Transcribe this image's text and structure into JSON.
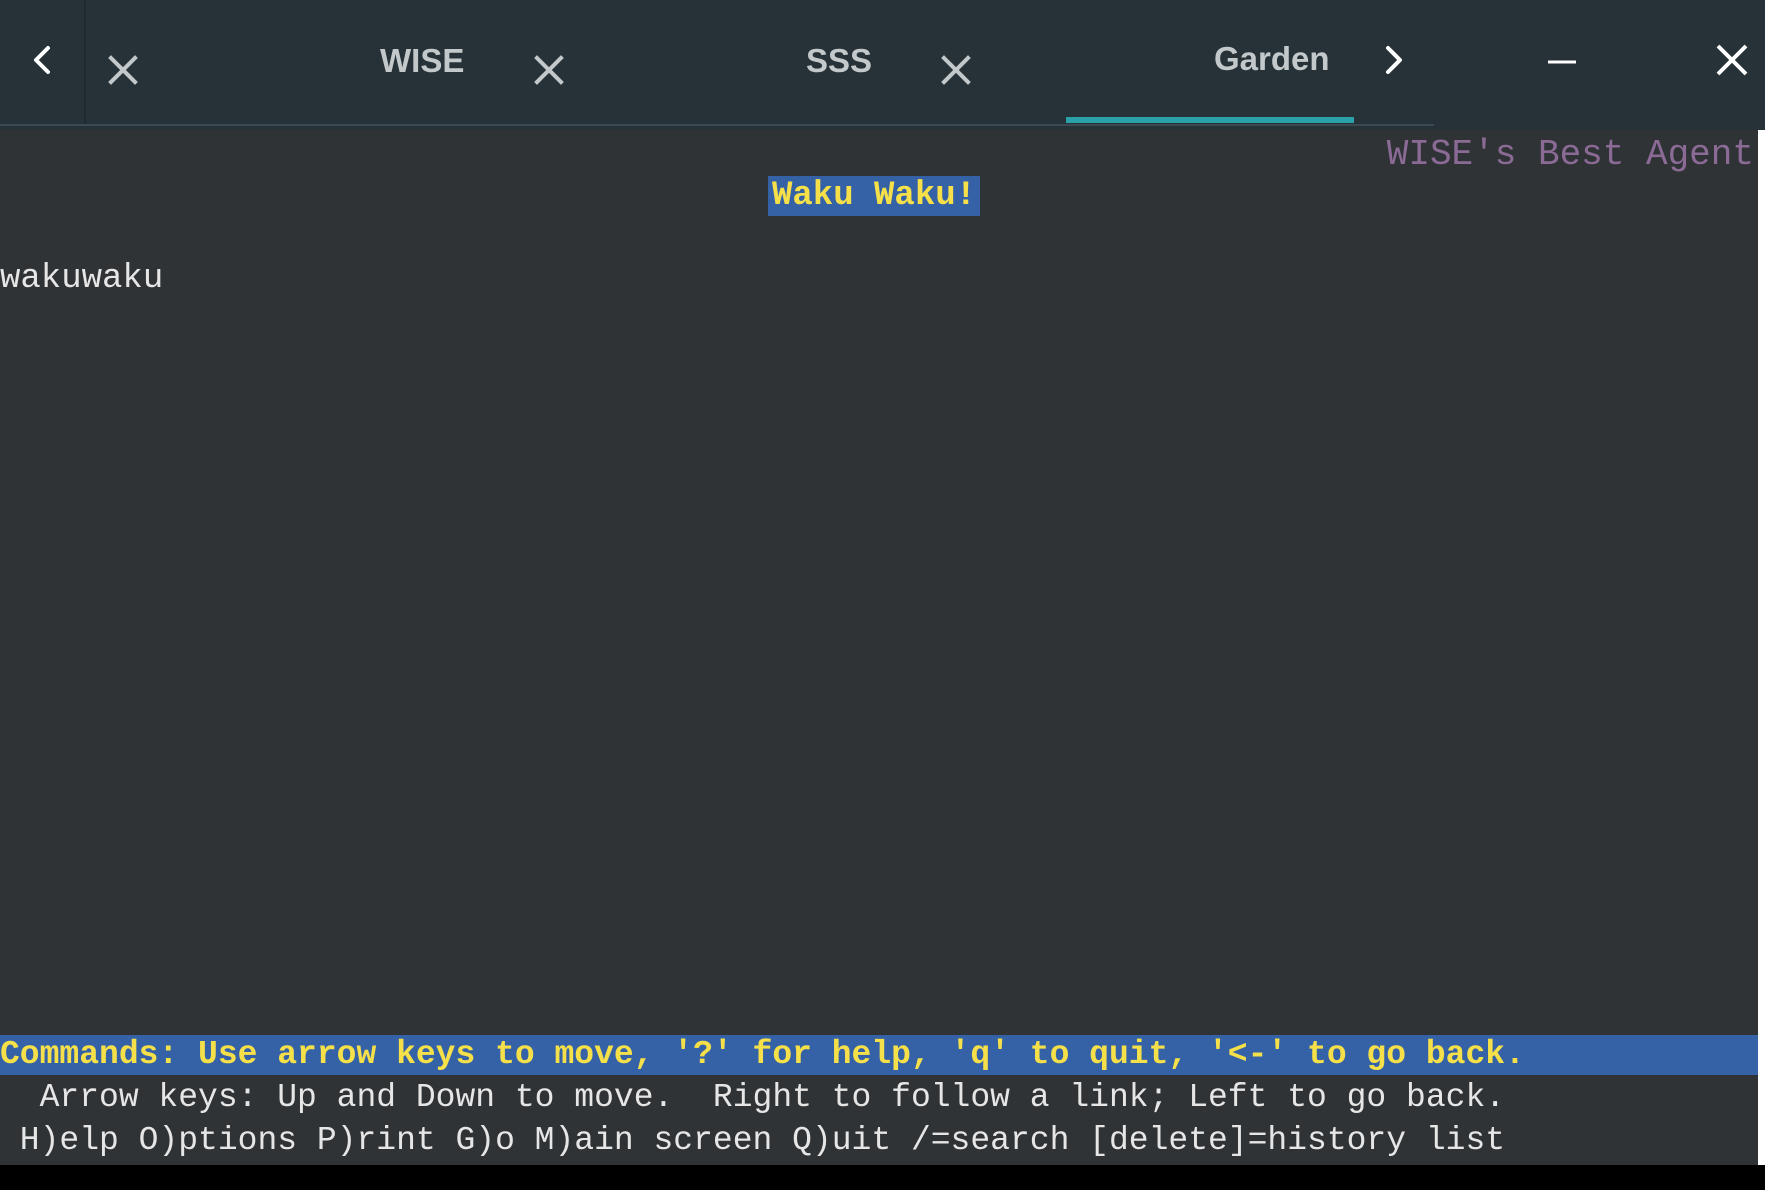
{
  "tabbar": {
    "nav_left_icon": "chevron-left-icon",
    "nav_right_icon": "chevron-right-icon",
    "tabs": [
      {
        "label": "",
        "close_icon": "close-icon",
        "active": false
      },
      {
        "label": "WISE",
        "close_icon": "close-icon",
        "active": false
      },
      {
        "label": "SSS",
        "close_icon": "close-icon",
        "active": false
      },
      {
        "label": "Garden",
        "active": true
      }
    ],
    "minimize_icon": "minimize-icon",
    "close_window_icon": "close-icon",
    "colors": {
      "background": "#263238",
      "active_underline": "#2aa0a8",
      "tab_text": "#c3c8ca"
    }
  },
  "terminal": {
    "agent_title": "WISE's Best Agent",
    "heading": "Waku Waku!",
    "body_text": "wakuwaku",
    "commands_bar": "Commands: Use arrow keys to move, '?' for help, 'q' to quit, '<-' to go back.",
    "help_line_1": "  Arrow keys: Up and Down to move.  Right to follow a link; Left to go back.",
    "help_line_2": " H)elp O)ptions P)rint G)o M)ain screen Q)uit /=search [delete]=history list",
    "colors": {
      "background": "#2f3336",
      "highlight_bg": "#3562a6",
      "highlight_fg": "#f5e04a",
      "agent_title": "#8b6b96",
      "text": "#e6e6e6"
    }
  }
}
